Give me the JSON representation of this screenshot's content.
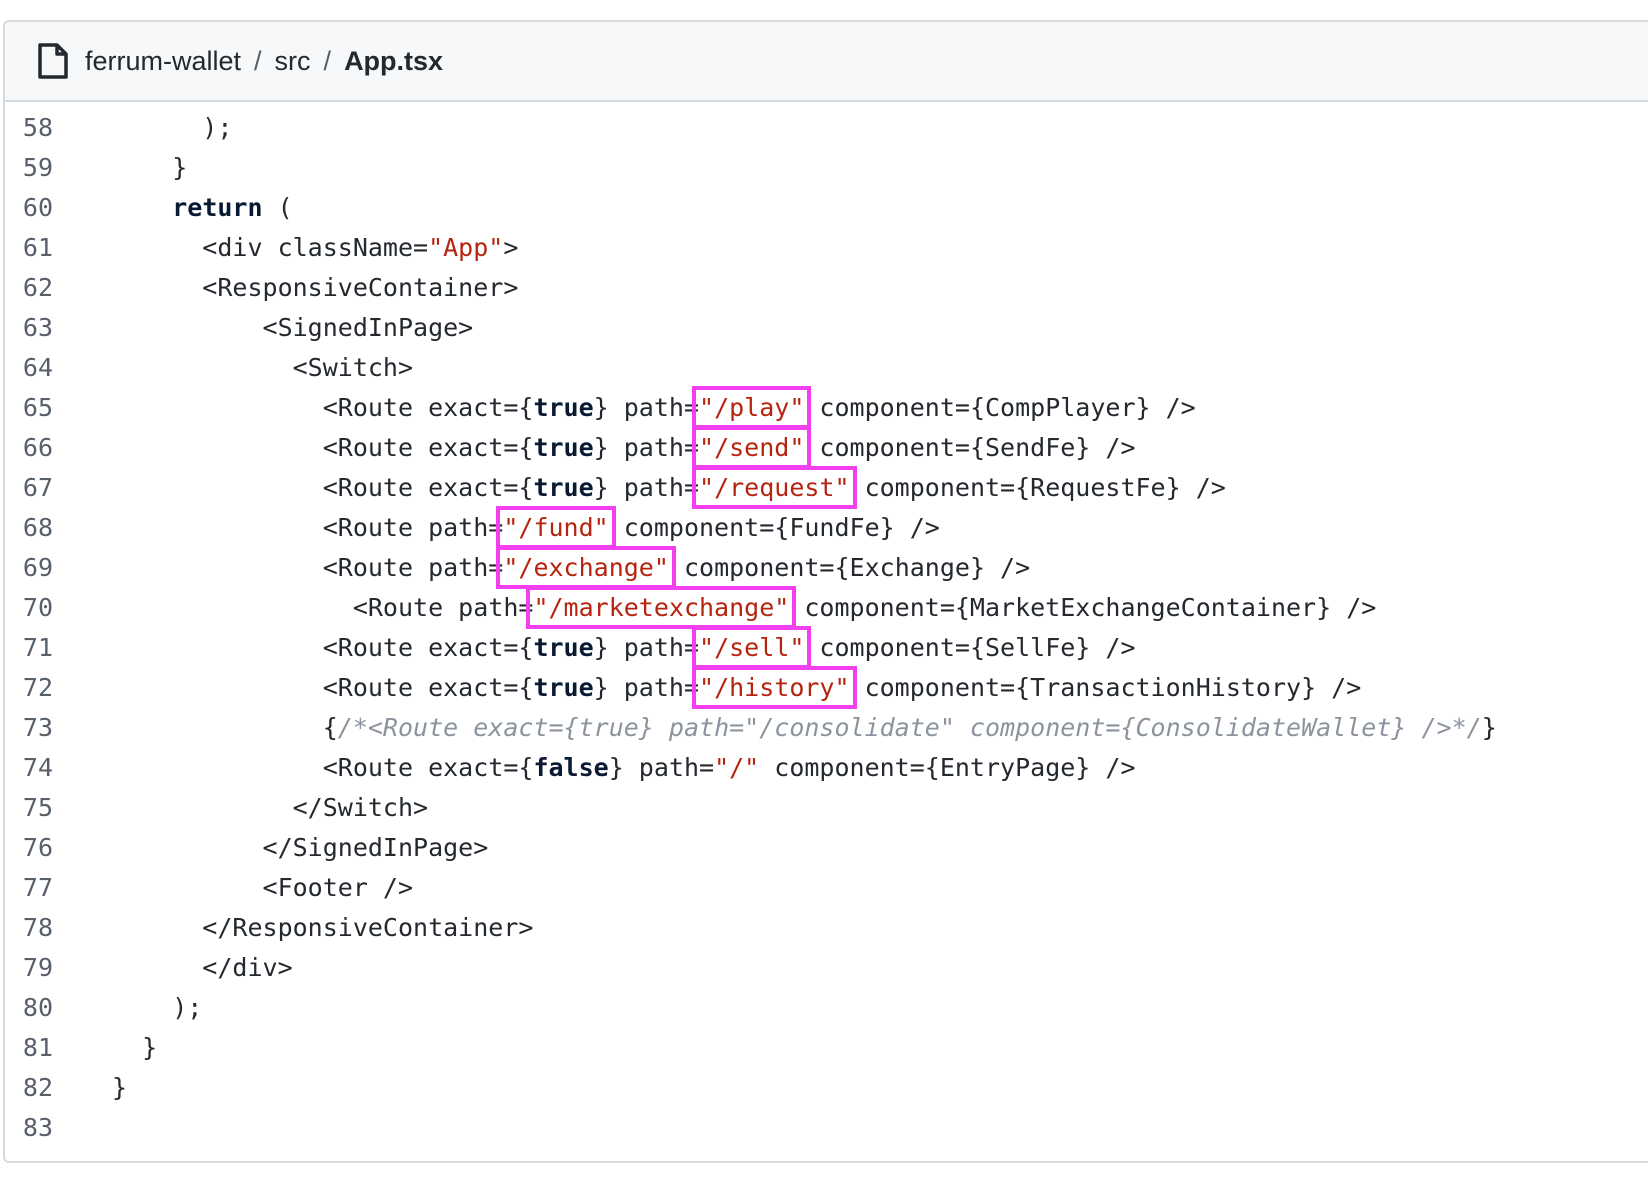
{
  "header": {
    "file_icon": "file-icon",
    "breadcrumb": [
      {
        "label": "ferrum-wallet"
      },
      {
        "label": "src"
      },
      {
        "label": "App.tsx"
      }
    ],
    "separator": "/"
  },
  "highlight_color": "#f33ff0",
  "code": {
    "lines": [
      {
        "n": "58",
        "tokens": [
          {
            "t": "      );"
          }
        ]
      },
      {
        "n": "59",
        "tokens": [
          {
            "t": "    }"
          }
        ]
      },
      {
        "n": "60",
        "tokens": [
          {
            "t": "    "
          },
          {
            "t": "return",
            "c": "kw"
          },
          {
            "t": " ("
          }
        ]
      },
      {
        "n": "61",
        "tokens": [
          {
            "t": "      <div className="
          },
          {
            "t": "\"App\"",
            "c": "str"
          },
          {
            "t": ">"
          }
        ]
      },
      {
        "n": "62",
        "tokens": [
          {
            "t": "      <ResponsiveContainer>"
          }
        ]
      },
      {
        "n": "63",
        "tokens": [
          {
            "t": "          <SignedInPage>"
          }
        ]
      },
      {
        "n": "64",
        "tokens": [
          {
            "t": "            <Switch>"
          }
        ]
      },
      {
        "n": "65",
        "tokens": [
          {
            "t": "              <Route exact={"
          },
          {
            "t": "true",
            "c": "kw"
          },
          {
            "t": "} path="
          },
          {
            "t": "\"/play\"",
            "c": "str",
            "hl": true
          },
          {
            "t": " component={CompPlayer} />"
          }
        ]
      },
      {
        "n": "66",
        "tokens": [
          {
            "t": "              <Route exact={"
          },
          {
            "t": "true",
            "c": "kw"
          },
          {
            "t": "} path="
          },
          {
            "t": "\"/send\"",
            "c": "str",
            "hl": true
          },
          {
            "t": " component={SendFe} />"
          }
        ]
      },
      {
        "n": "67",
        "tokens": [
          {
            "t": "              <Route exact={"
          },
          {
            "t": "true",
            "c": "kw"
          },
          {
            "t": "} path="
          },
          {
            "t": "\"/request\"",
            "c": "str",
            "hl": true
          },
          {
            "t": " component={RequestFe} />"
          }
        ]
      },
      {
        "n": "68",
        "tokens": [
          {
            "t": "              <Route path="
          },
          {
            "t": "\"/fund\"",
            "c": "str",
            "hl": true
          },
          {
            "t": " component={FundFe} />"
          }
        ]
      },
      {
        "n": "69",
        "tokens": [
          {
            "t": "              <Route path="
          },
          {
            "t": "\"/exchange\"",
            "c": "str",
            "hl": true
          },
          {
            "t": " component={Exchange} />"
          }
        ]
      },
      {
        "n": "70",
        "tokens": [
          {
            "t": "                <Route path="
          },
          {
            "t": "\"/marketexchange\"",
            "c": "str",
            "hl": true
          },
          {
            "t": " component={MarketExchangeContainer} />"
          }
        ]
      },
      {
        "n": "71",
        "tokens": [
          {
            "t": "              <Route exact={"
          },
          {
            "t": "true",
            "c": "kw"
          },
          {
            "t": "} path="
          },
          {
            "t": "\"/sell\"",
            "c": "str",
            "hl": true
          },
          {
            "t": " component={SellFe} />"
          }
        ]
      },
      {
        "n": "72",
        "tokens": [
          {
            "t": "              <Route exact={"
          },
          {
            "t": "true",
            "c": "kw"
          },
          {
            "t": "} path="
          },
          {
            "t": "\"/history\"",
            "c": "str",
            "hl": true
          },
          {
            "t": " component={TransactionHistory} />"
          }
        ]
      },
      {
        "n": "73",
        "tokens": [
          {
            "t": "              {"
          },
          {
            "t": "/*<Route exact={true} path=\"/consolidate\" component={ConsolidateWallet} />*/",
            "c": "cmt"
          },
          {
            "t": "}"
          }
        ]
      },
      {
        "n": "74",
        "tokens": [
          {
            "t": "              <Route exact={"
          },
          {
            "t": "false",
            "c": "kw"
          },
          {
            "t": "} path="
          },
          {
            "t": "\"/\"",
            "c": "str"
          },
          {
            "t": " component={EntryPage} />"
          }
        ]
      },
      {
        "n": "75",
        "tokens": [
          {
            "t": "            </Switch>"
          }
        ]
      },
      {
        "n": "76",
        "tokens": [
          {
            "t": "          </SignedInPage>"
          }
        ]
      },
      {
        "n": "77",
        "tokens": [
          {
            "t": "          <Footer />"
          }
        ]
      },
      {
        "n": "78",
        "tokens": [
          {
            "t": "      </ResponsiveContainer>"
          }
        ]
      },
      {
        "n": "79",
        "tokens": [
          {
            "t": "      </div>"
          }
        ]
      },
      {
        "n": "80",
        "tokens": [
          {
            "t": "    );"
          }
        ]
      },
      {
        "n": "81",
        "tokens": [
          {
            "t": "  }"
          }
        ]
      },
      {
        "n": "82",
        "tokens": [
          {
            "t": "}"
          }
        ]
      },
      {
        "n": "83",
        "tokens": [
          {
            "t": ""
          }
        ]
      }
    ]
  }
}
